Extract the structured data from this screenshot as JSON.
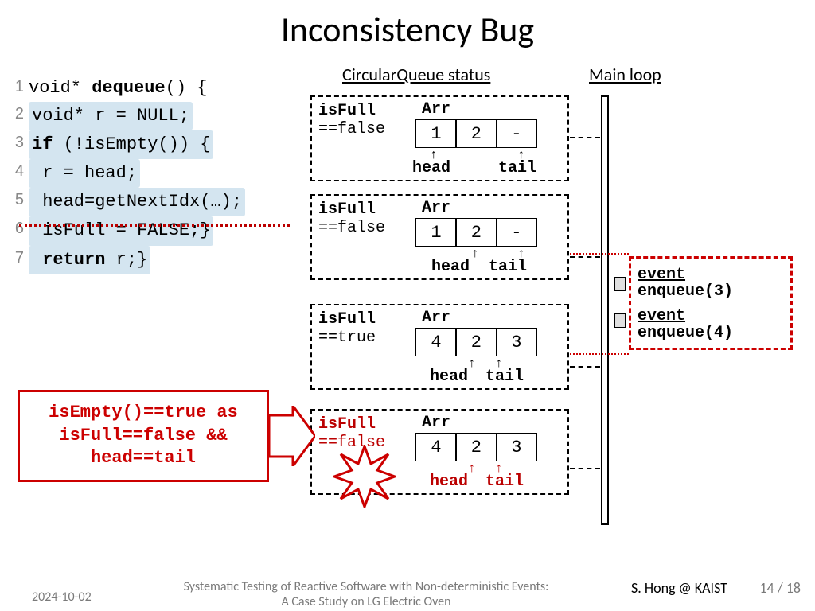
{
  "title": "Inconsistency Bug",
  "code": {
    "l1": "void* dequeue() {",
    "l1b": "dequeue",
    "l2": "void* r = NULL;",
    "l3": "if (!isEmpty()) {",
    "l4": " r = head;",
    "l5": " head=getNextIdx(…);",
    "l6": " isFull = FALSE;}",
    "l7": "return r;}"
  },
  "headings": {
    "cq": "CircularQueue status",
    "ml": "Main loop"
  },
  "states": [
    {
      "isfull": "isFull",
      "val": "==false",
      "arr": "Arr",
      "cells": [
        "1",
        "2",
        "-"
      ],
      "head": "head",
      "tail": "tail"
    },
    {
      "isfull": "isFull",
      "val": "==false",
      "arr": "Arr",
      "cells": [
        "1",
        "2",
        "-"
      ],
      "head": "head",
      "tail": "tail"
    },
    {
      "isfull": "isFull",
      "val": "==true",
      "arr": "Arr",
      "cells": [
        "4",
        "2",
        "3"
      ],
      "head": "head",
      "tail": "tail"
    },
    {
      "isfull": "isFull",
      "val": "==false",
      "arr": "Arr",
      "cells": [
        "4",
        "2",
        "3"
      ],
      "head": "head",
      "tail": "tail"
    }
  ],
  "events": {
    "e1lbl": "event",
    "e1call": "enqueue(3)",
    "e2lbl": "event",
    "e2call": "enqueue(4)"
  },
  "callout": {
    "l1": "isEmpty()==true as",
    "l2": "isFull==false &&",
    "l3": "head==tail"
  },
  "footer": {
    "date": "2024-10-02",
    "subtitle1": "Systematic Testing of Reactive Software with Non-deterministic Events:",
    "subtitle2": "A Case Study on LG Electric Oven",
    "author": "S. Hong @ KAIST",
    "page": "14 / 18"
  }
}
